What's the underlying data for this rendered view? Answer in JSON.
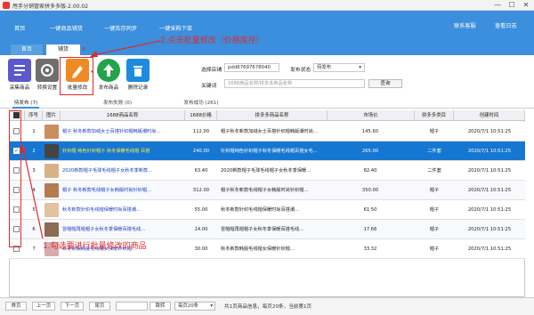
{
  "window": {
    "title": "甩手分销管家拼多多版-2.00.02",
    "minimize": "—",
    "maximize": "☐",
    "close": "✕"
  },
  "menu": {
    "items": [
      "首页",
      "一键商品铺货",
      "一键库存同步",
      "一键采购下单"
    ],
    "contact": "联系客服",
    "log": "查看日志"
  },
  "tabs": {
    "home": "首页",
    "shop": "铺货",
    "close": "×"
  },
  "toolbar": {
    "buttons": [
      {
        "label": "采集商品",
        "color": "#5a5acb",
        "icon": "collect-icon"
      },
      {
        "label": "转换设置",
        "color": "#6e6e6e",
        "icon": "settings-icon"
      },
      {
        "label": "批量修改",
        "color": "#f08a24",
        "icon": "edit-icon"
      },
      {
        "label": "发布商品",
        "color": "#23a34a",
        "icon": "upload-icon"
      },
      {
        "label": "删除记录",
        "color": "#1c8be0",
        "icon": "trash-icon"
      }
    ],
    "store_label": "选择店铺",
    "store_value": "pdd67697678040",
    "status_label": "发布状态",
    "status_value": "待发布",
    "keyword_label": "关键词",
    "keyword_placeholder": "1688商品名称/拼多多商品名称",
    "search_label": "查询"
  },
  "subtabs": [
    {
      "label": "待发布 (7)"
    },
    {
      "label": "发布失败 (0)"
    },
    {
      "label": "发布成功 (261)"
    }
  ],
  "columns": [
    "序号",
    "图片",
    "1688商品名称",
    "1688价格",
    "拼多多商品名称",
    "市场价",
    "拼多多类目",
    "创建时间"
  ],
  "rows": [
    {
      "no": "1",
      "name1688": "帽子 秋冬新款加绒女士百搭针织帽韩版潮时尚…",
      "price": "112.00",
      "pdd": "帽子秋冬新款加绒女士百搭针织帽韩版潮时尚…",
      "market": "145.60",
      "cat": "帽子",
      "time": "2020/7/1 10:51:25",
      "checked": false,
      "thumb": "#c98f63"
    },
    {
      "no": "2",
      "name1688": "针织帽 纯色针织帽子 秋冬保暖毛线帽 百搭",
      "price": "240.00",
      "pdd": "针织帽纯色针织帽子秋冬保暖毛线帽百搭女毛…",
      "market": "265.00",
      "cat": "二件套",
      "time": "2020/7/1 10:51:25",
      "checked": true,
      "thumb": "#444444"
    },
    {
      "no": "3",
      "name1688": "2020新款帽子毛球毛线帽子女秋冬季新款…",
      "price": "63.40",
      "pdd": "2020新款帽子毛球毛线帽子女秋冬季保暖…",
      "market": "82.40",
      "cat": "二件套",
      "time": "2020/7/1 10:51:25",
      "checked": false,
      "thumb": "#d8b18a"
    },
    {
      "no": "4",
      "name1688": "帽子 秋冬新款毛线帽子女韩版时尚针织帽…",
      "price": "312.00",
      "pdd": "帽子秋冬新款毛线帽子女韩版时尚针织帽…",
      "market": "350.00",
      "cat": "帽子",
      "time": "2020/7/1 10:51:25",
      "checked": false,
      "thumb": "#b57a4f"
    },
    {
      "no": "5",
      "name1688": "秋冬新款针织毛线帽保暖时尚百搭潮…",
      "price": "55.00",
      "pdd": "秋冬新款针织毛线帽保暖时尚百搭潮…",
      "market": "61.50",
      "cat": "帽子",
      "time": "2020/7/1 10:51:25",
      "checked": false,
      "thumb": "#e2c2a0"
    },
    {
      "no": "6",
      "name1688": "冒帽帽再帽帽子女秋冬季保暖百搭毛线…",
      "price": "14.00",
      "pdd": "冒帽帽再帽帽子女秋冬季保暖百搭毛线…",
      "market": "17.66",
      "cat": "帽子",
      "time": "2020/7/1 10:51:25",
      "checked": false,
      "thumb": "#8a6b56"
    },
    {
      "no": "7",
      "name1688": "秋冬新款韩版毛线帽女保暖针织帽…",
      "price": "30.00",
      "pdd": "秋冬新款韩版毛线帽女保暖针织帽…",
      "market": "33.32",
      "cat": "帽子",
      "time": "2020/7/1 10:51:25",
      "checked": false,
      "thumb": "#d9a9b0"
    }
  ],
  "annotations": {
    "step1": "1.勾选要进行批量修改的商品",
    "step2": "2.点击批量修改（价格库存）"
  },
  "pager": {
    "home": "首页",
    "prev": "上一页",
    "next": "下一页",
    "last": "尾页",
    "jump": "跳转",
    "per_page": "每页20条",
    "info": "共1页商品信息，每页20条，当前第1页"
  }
}
